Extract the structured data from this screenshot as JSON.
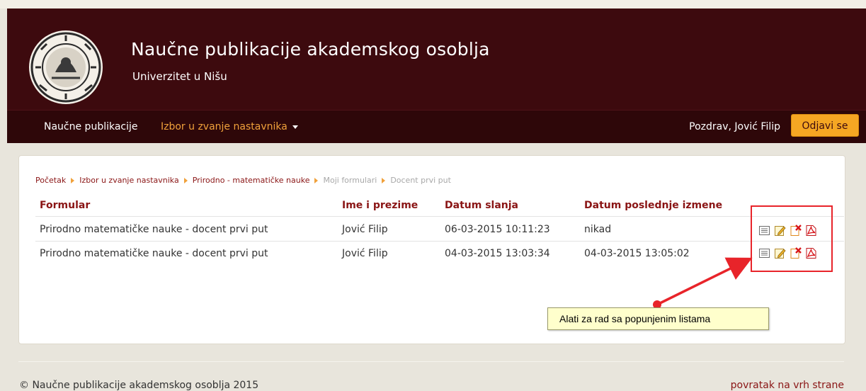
{
  "header": {
    "title": "Naučne publikacije akademskog osoblja",
    "subtitle": "Univerzitet u Nišu",
    "logo_icon": "university-seal-icon"
  },
  "nav": {
    "items": [
      {
        "label": "Naučne publikacije"
      },
      {
        "label": "Izbor u zvanje nastavnika"
      }
    ],
    "greeting": "Pozdrav, Jović Filip",
    "logout_label": "Odjavi se"
  },
  "breadcrumb": [
    "Početak",
    "Izbor u zvanje nastavnika",
    "Prirodno - matematičke nauke",
    "Moji formulari",
    "Docent prvi put"
  ],
  "table": {
    "headers": [
      "Formular",
      "Ime i prezime",
      "Datum slanja",
      "Datum poslednje izmene"
    ],
    "rows": [
      [
        "Prirodno matematičke nauke - docent prvi put",
        "Jović Filip",
        "06-03-2015 10:11:23",
        "nikad"
      ],
      [
        "Prirodno matematičke nauke - docent prvi put",
        "Jović Filip",
        "04-03-2015 13:03:34",
        "04-03-2015 13:05:02"
      ]
    ],
    "row_tools": [
      "list-icon",
      "edit-icon",
      "delete-icon",
      "pdf-icon"
    ]
  },
  "annotation": {
    "text": "Alati za rad sa popunjenim listama"
  },
  "footer": {
    "copyright": "© Naučne publikacije akademskog osoblja 2015",
    "back_to_top": "povratak na vrh strane"
  },
  "colors": {
    "header_bg": "#3d0a0e",
    "accent": "#f0a13b",
    "link": "#8a1515",
    "annotation": "#e8242a"
  }
}
